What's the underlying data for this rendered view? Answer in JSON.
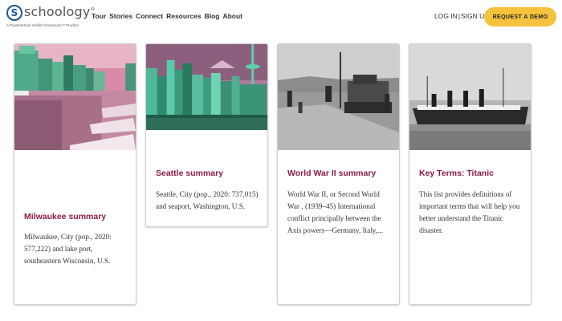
{
  "header": {
    "logo_text": "schoology",
    "logo_trademark": "®",
    "logo_tagline": "A PowerSchool Unified Classroom™ Product",
    "nav": [
      "Tour",
      "Stories",
      "Connect",
      "Resources",
      "Blog",
      "About"
    ],
    "login_label": "LOG IN",
    "login_separator": "|",
    "signup_label": "SIGN UP",
    "demo_label": "REQUEST A DEMO"
  },
  "cards": [
    {
      "title": "Milwaukee summary",
      "text": "Milwaukee, City (pop., 2020: 577,222) and lake port, southeastern Wisconsin, U.S.",
      "image": "milwaukee-harbor-photo"
    },
    {
      "title": "Seattle summary",
      "text": "Seattle, City (pop., 2020: 737,015) and seaport, Washington, U.S.",
      "image": "seattle-skyline-photo"
    },
    {
      "title": "World War II summary",
      "text": "World War II, or Second World War , (1939–45) International conflict principally between the Axis powers—Germany, Italy,...",
      "image": "ww2-tank-photo"
    },
    {
      "title": "Key Terms: Titanic",
      "text": "This list provides definitions of important terms that will help you better understand the Titanic disaster.",
      "image": "titanic-ship-photo"
    }
  ],
  "colors": {
    "accent": "#f5c23d",
    "title": "#8a1b45",
    "logo_blue": "#1a5a8f"
  }
}
